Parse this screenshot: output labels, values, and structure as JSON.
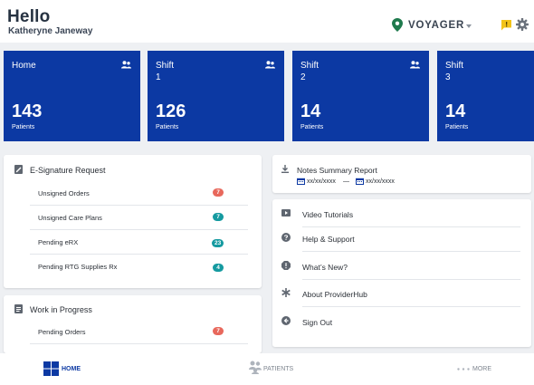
{
  "header": {
    "greeting": "Hello",
    "user_name": "Katheryne Janeway",
    "facility": "VOYAGER",
    "icons": [
      "location-pin-icon",
      "chevron-down-icon",
      "notification-icon",
      "gear-icon"
    ]
  },
  "cards": [
    {
      "title": "Home",
      "subtitle": "",
      "value": "143",
      "label": "Patients"
    },
    {
      "title": "Shift",
      "subtitle": "1",
      "value": "126",
      "label": "Patients"
    },
    {
      "title": "Shift",
      "subtitle": "2",
      "value": "14",
      "label": "Patients"
    },
    {
      "title": "Shift",
      "subtitle": "3",
      "value": "14",
      "label": "Patients"
    }
  ],
  "esign": {
    "title": "E-Signature Request",
    "rows": [
      {
        "label": "Unsigned Orders",
        "count": "7",
        "color": "#e8685c"
      },
      {
        "label": "Unsigned Care Plans",
        "count": "7",
        "color": "#159aa0"
      },
      {
        "label": "Pending eRX",
        "count": "23",
        "color": "#159aa0"
      },
      {
        "label": "Pending RTG Supplies Rx",
        "count": "4",
        "color": "#159aa0"
      }
    ]
  },
  "wip": {
    "title": "Work in Progress",
    "rows": [
      {
        "label": "Pending Orders",
        "count": "7",
        "color": "#e8685c"
      }
    ]
  },
  "notes": {
    "title": "Notes Summary Report",
    "from": "xx/xx/xxxx",
    "separator": "—",
    "to": "xx/xx/xxxx"
  },
  "menu": [
    {
      "label": "Video Tutorials",
      "icon": "video-icon"
    },
    {
      "label": "Help & Support",
      "icon": "help-icon"
    },
    {
      "label": "What’s New?",
      "icon": "alert-icon"
    },
    {
      "label": "About ProviderHub",
      "icon": "asterisk-icon"
    },
    {
      "label": "Sign Out",
      "icon": "sign-out-icon"
    }
  ],
  "nav": {
    "home": "HOME",
    "patients": "PATIENTS",
    "more": "MORE"
  },
  "colors": {
    "card_blue": "#0c39a3",
    "accent_green": "#1f7a4d",
    "badge_red": "#e8685c",
    "badge_teal": "#159aa0",
    "notification_yellow": "#f2c318"
  }
}
